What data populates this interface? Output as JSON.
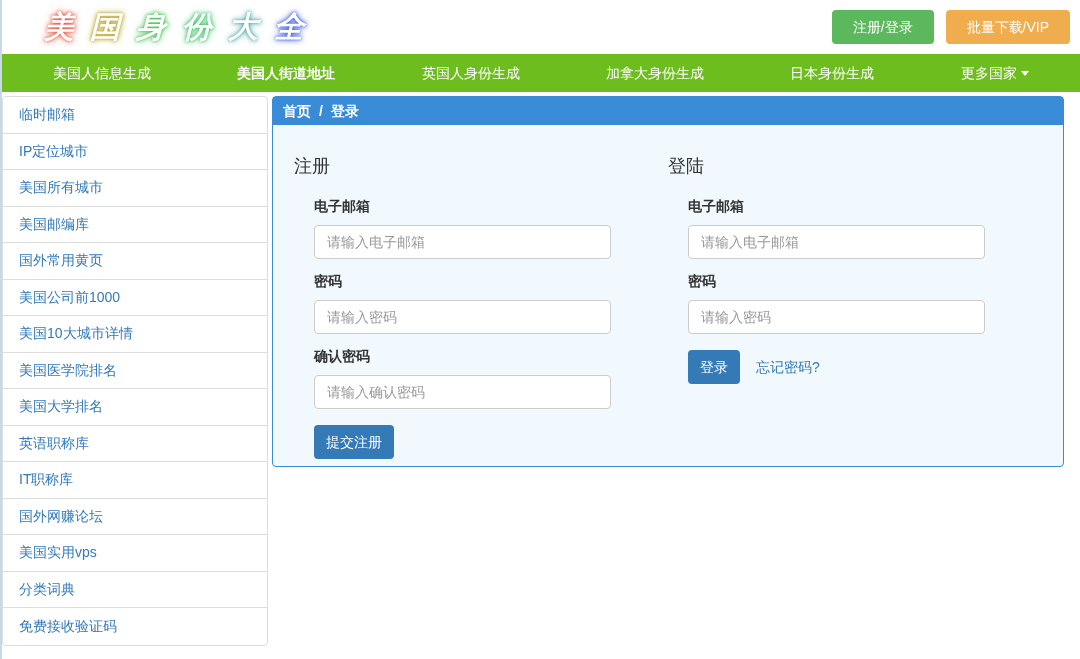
{
  "logo": "美国身份大全",
  "header_buttons": [
    {
      "label": "注册/登录",
      "kind": "success"
    },
    {
      "label": "批量下载/VIP",
      "kind": "warning"
    }
  ],
  "nav": [
    {
      "label": "美国人信息生成",
      "selected": false
    },
    {
      "label": "美国人街道地址",
      "selected": true
    },
    {
      "label": "英国人身份生成",
      "selected": false
    },
    {
      "label": "加拿大身份生成",
      "selected": false
    },
    {
      "label": "日本身份生成",
      "selected": false
    },
    {
      "label": "更多国家",
      "selected": false,
      "dropdown": true
    }
  ],
  "sidebar": {
    "items": [
      "临时邮箱",
      "IP定位城市",
      "美国所有城市",
      "美国邮编库",
      "国外常用黄页",
      "美国公司前1000",
      "美国10大城市详情",
      "美国医学院排名",
      "美国大学排名",
      "英语职称库",
      "IT职称库",
      "国外网赚论坛",
      "美国实用vps",
      "分类词典",
      "免费接收验证码"
    ]
  },
  "breadcrumb": [
    "首页",
    "/",
    "登录"
  ],
  "register": {
    "title": "注册",
    "fields": [
      {
        "label": "电子邮箱",
        "placeholder": "请输入电子邮箱"
      },
      {
        "label": "密码",
        "placeholder": "请输入密码"
      },
      {
        "label": "确认密码",
        "placeholder": "请输入确认密码"
      }
    ],
    "submit": "提交注册"
  },
  "login": {
    "title": "登陆",
    "fields": [
      {
        "label": "电子邮箱",
        "placeholder": "请输入电子邮箱"
      },
      {
        "label": "密码",
        "placeholder": "请输入密码"
      }
    ],
    "submit": "登录",
    "forgot": "忘记密码?"
  }
}
